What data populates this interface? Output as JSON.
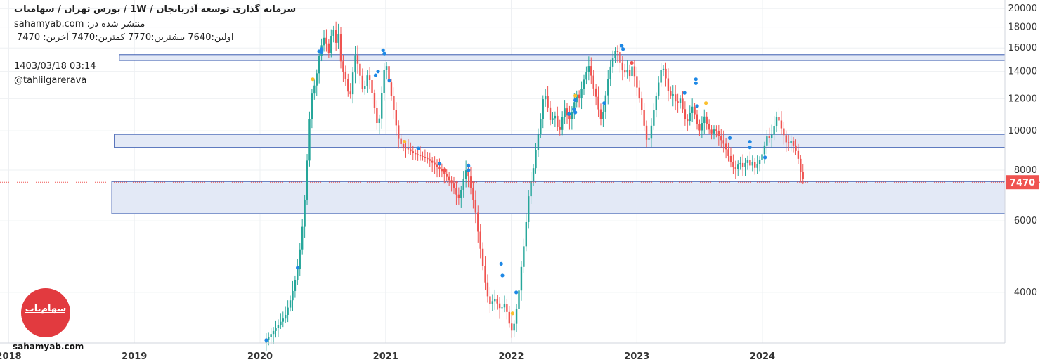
{
  "header": {
    "title": "سرمایه گذاری توسعه آذربایجان  /  1W  /  بورس تهران / سهامیاب",
    "published": "sahamyab.com :منتشر شده در",
    "ohlc_line1": "اولین:7640  بیشترین:7770  کمترین:7470  آخرین:",
    "ohlc_line2": "7470",
    "datetime": "1403/03/18 03:14",
    "author": "@tahlilgarerava"
  },
  "brand": {
    "wordmark": "sahamyab.com",
    "logo_text": "سهام‌یاب",
    "logo_color": "#e23a3f"
  },
  "chart_data": {
    "type": "candlestick",
    "interval": "1W",
    "price_scale": "log",
    "ylim": [
      3000,
      21000
    ],
    "xlim": [
      2017.93,
      2025.93
    ],
    "y_ticks": [
      4000,
      6000,
      8000,
      10000,
      12000,
      14000,
      16000,
      18000,
      20000
    ],
    "y_tick_labels": [
      "4000",
      "6000",
      "8000",
      "10000",
      "12000",
      "14000",
      "16000",
      "18000",
      "20000"
    ],
    "x_ticks": [
      2018,
      2019,
      2020,
      2021,
      2022,
      2023,
      2024
    ],
    "x_tick_labels": [
      "2018",
      "2019",
      "2020",
      "2021",
      "2022",
      "2023",
      "2024"
    ],
    "last_price": 7470,
    "last_price_label": "7470",
    "grid": true,
    "colors": {
      "up": "#26a69a",
      "down": "#ef5350",
      "zone_fill": "#e3e9f6",
      "zone_border": "#3a5bb0",
      "price_tag": "#ef5350",
      "dot_blue": "#1e88e5",
      "dot_yellow": "#fbc02d",
      "dot_red": "#ef5350"
    },
    "zones": [
      {
        "x_start": 2018.88,
        "x_end": 2025.93,
        "low": 14900,
        "high": 15400
      },
      {
        "x_start": 2018.84,
        "x_end": 2025.93,
        "low": 9100,
        "high": 9800
      },
      {
        "x_start": 2018.82,
        "x_end": 2025.93,
        "low": 6250,
        "high": 7500
      }
    ],
    "price_path": [
      [
        2020.03,
        3000
      ],
      [
        2020.12,
        3250
      ],
      [
        2020.2,
        3500
      ],
      [
        2020.25,
        3900
      ],
      [
        2020.3,
        4600
      ],
      [
        2020.33,
        5500
      ],
      [
        2020.36,
        7000
      ],
      [
        2020.38,
        9000
      ],
      [
        2020.4,
        11500
      ],
      [
        2020.42,
        12800
      ],
      [
        2020.44,
        13000
      ],
      [
        2020.46,
        14500
      ],
      [
        2020.48,
        16000
      ],
      [
        2020.5,
        16500
      ],
      [
        2020.52,
        17500
      ],
      [
        2020.54,
        15000
      ],
      [
        2020.56,
        16500
      ],
      [
        2020.58,
        18500
      ],
      [
        2020.6,
        16000
      ],
      [
        2020.62,
        18000
      ],
      [
        2020.64,
        15000
      ],
      [
        2020.66,
        14000
      ],
      [
        2020.68,
        13500
      ],
      [
        2020.7,
        12500
      ],
      [
        2020.72,
        12300
      ],
      [
        2020.74,
        14000
      ],
      [
        2020.76,
        15500
      ],
      [
        2020.78,
        14500
      ],
      [
        2020.8,
        13500
      ],
      [
        2020.82,
        12500
      ],
      [
        2020.84,
        13000
      ],
      [
        2020.86,
        14000
      ],
      [
        2020.88,
        13000
      ],
      [
        2020.9,
        12000
      ],
      [
        2020.92,
        11000
      ],
      [
        2020.94,
        10000
      ],
      [
        2020.96,
        11500
      ],
      [
        2020.98,
        13500
      ],
      [
        2021.0,
        15000
      ],
      [
        2021.02,
        13500
      ],
      [
        2021.04,
        12500
      ],
      [
        2021.06,
        11500
      ],
      [
        2021.08,
        10500
      ],
      [
        2021.1,
        9600
      ],
      [
        2021.12,
        9300
      ],
      [
        2021.14,
        9100
      ],
      [
        2021.18,
        9000
      ],
      [
        2021.22,
        8800
      ],
      [
        2021.26,
        8700
      ],
      [
        2021.3,
        8600
      ],
      [
        2021.34,
        8500
      ],
      [
        2021.38,
        8300
      ],
      [
        2021.42,
        8100
      ],
      [
        2021.46,
        7900
      ],
      [
        2021.5,
        7600
      ],
      [
        2021.54,
        7300
      ],
      [
        2021.56,
        7000
      ],
      [
        2021.58,
        6800
      ],
      [
        2021.6,
        7100
      ],
      [
        2021.62,
        7600
      ],
      [
        2021.64,
        8000
      ],
      [
        2021.66,
        7700
      ],
      [
        2021.68,
        7200
      ],
      [
        2021.7,
        6700
      ],
      [
        2021.72,
        6200
      ],
      [
        2021.74,
        5500
      ],
      [
        2021.76,
        5000
      ],
      [
        2021.78,
        4500
      ],
      [
        2021.8,
        4100
      ],
      [
        2021.82,
        3800
      ],
      [
        2021.84,
        3700
      ],
      [
        2021.86,
        3900
      ],
      [
        2021.88,
        3800
      ],
      [
        2021.9,
        3700
      ],
      [
        2021.92,
        3600
      ],
      [
        2021.94,
        3800
      ],
      [
        2021.96,
        3650
      ],
      [
        2021.98,
        3400
      ],
      [
        2022.0,
        3200
      ],
      [
        2022.02,
        3300
      ],
      [
        2022.04,
        3600
      ],
      [
        2022.06,
        4000
      ],
      [
        2022.08,
        4600
      ],
      [
        2022.1,
        5200
      ],
      [
        2022.12,
        6000
      ],
      [
        2022.14,
        7000
      ],
      [
        2022.16,
        7600
      ],
      [
        2022.18,
        8200
      ],
      [
        2022.2,
        9200
      ],
      [
        2022.22,
        10000
      ],
      [
        2022.24,
        11000
      ],
      [
        2022.26,
        12500
      ],
      [
        2022.28,
        12000
      ],
      [
        2022.3,
        11000
      ],
      [
        2022.32,
        10300
      ],
      [
        2022.34,
        11200
      ],
      [
        2022.36,
        10500
      ],
      [
        2022.38,
        9800
      ],
      [
        2022.4,
        10500
      ],
      [
        2022.42,
        11500
      ],
      [
        2022.44,
        11000
      ],
      [
        2022.46,
        10600
      ],
      [
        2022.48,
        11000
      ],
      [
        2022.5,
        11700
      ],
      [
        2022.52,
        12300
      ],
      [
        2022.54,
        12000
      ],
      [
        2022.56,
        12700
      ],
      [
        2022.58,
        13400
      ],
      [
        2022.6,
        14000
      ],
      [
        2022.62,
        14500
      ],
      [
        2022.64,
        13500
      ],
      [
        2022.66,
        12500
      ],
      [
        2022.68,
        12000
      ],
      [
        2022.7,
        11000
      ],
      [
        2022.72,
        10500
      ],
      [
        2022.74,
        11500
      ],
      [
        2022.76,
        12800
      ],
      [
        2022.78,
        14000
      ],
      [
        2022.8,
        14800
      ],
      [
        2022.82,
        15500
      ],
      [
        2022.84,
        16000
      ],
      [
        2022.86,
        15000
      ],
      [
        2022.88,
        14200
      ],
      [
        2022.9,
        13800
      ],
      [
        2022.92,
        14300
      ],
      [
        2022.94,
        13500
      ],
      [
        2022.96,
        14500
      ],
      [
        2022.98,
        13700
      ],
      [
        2023.0,
        12800
      ],
      [
        2023.02,
        12000
      ],
      [
        2023.04,
        11200
      ],
      [
        2023.06,
        10200
      ],
      [
        2023.08,
        9400
      ],
      [
        2023.1,
        9600
      ],
      [
        2023.12,
        10500
      ],
      [
        2023.14,
        11500
      ],
      [
        2023.16,
        12500
      ],
      [
        2023.18,
        13500
      ],
      [
        2023.2,
        14500
      ],
      [
        2023.22,
        14000
      ],
      [
        2023.24,
        13000
      ],
      [
        2023.26,
        12000
      ],
      [
        2023.28,
        12500
      ],
      [
        2023.3,
        12000
      ],
      [
        2023.32,
        11500
      ],
      [
        2023.34,
        12200
      ],
      [
        2023.36,
        11500
      ],
      [
        2023.38,
        10700
      ],
      [
        2023.4,
        10500
      ],
      [
        2023.42,
        11000
      ],
      [
        2023.44,
        11500
      ],
      [
        2023.46,
        11000
      ],
      [
        2023.48,
        10400
      ],
      [
        2023.5,
        10000
      ],
      [
        2023.52,
        10500
      ],
      [
        2023.54,
        10900
      ],
      [
        2023.56,
        10300
      ],
      [
        2023.58,
        10000
      ],
      [
        2023.6,
        9800
      ],
      [
        2023.62,
        10200
      ],
      [
        2023.64,
        9900
      ],
      [
        2023.66,
        9600
      ],
      [
        2023.68,
        9400
      ],
      [
        2023.7,
        9200
      ],
      [
        2023.72,
        8800
      ],
      [
        2023.74,
        8500
      ],
      [
        2023.76,
        8200
      ],
      [
        2023.78,
        8000
      ],
      [
        2023.8,
        8200
      ],
      [
        2023.82,
        8400
      ],
      [
        2023.84,
        8100
      ],
      [
        2023.86,
        8300
      ],
      [
        2023.88,
        8500
      ],
      [
        2023.9,
        8200
      ],
      [
        2023.92,
        8400
      ],
      [
        2023.94,
        8100
      ],
      [
        2023.96,
        8300
      ],
      [
        2023.98,
        8500
      ],
      [
        2024.0,
        8800
      ],
      [
        2024.02,
        9300
      ],
      [
        2024.04,
        9800
      ],
      [
        2024.06,
        9500
      ],
      [
        2024.08,
        9900
      ],
      [
        2024.1,
        10500
      ],
      [
        2024.12,
        11000
      ],
      [
        2024.14,
        10300
      ],
      [
        2024.16,
        10000
      ],
      [
        2024.18,
        9500
      ],
      [
        2024.2,
        9200
      ],
      [
        2024.22,
        9500
      ],
      [
        2024.24,
        9300
      ],
      [
        2024.26,
        9000
      ],
      [
        2024.28,
        8700
      ],
      [
        2024.3,
        8000
      ],
      [
        2024.32,
        7640
      ],
      [
        2024.34,
        7470
      ]
    ],
    "signal_dots": [
      {
        "x": 2020.05,
        "y": 3050,
        "c": "blue"
      },
      {
        "x": 2020.3,
        "y": 4600,
        "c": "blue"
      },
      {
        "x": 2020.42,
        "y": 13400,
        "c": "yellow"
      },
      {
        "x": 2020.47,
        "y": 15700,
        "c": "blue"
      },
      {
        "x": 2020.49,
        "y": 15900,
        "c": "blue"
      },
      {
        "x": 2020.49,
        "y": 15600,
        "c": "blue"
      },
      {
        "x": 2020.92,
        "y": 13700,
        "c": "blue"
      },
      {
        "x": 2020.94,
        "y": 14000,
        "c": "blue"
      },
      {
        "x": 2020.98,
        "y": 15800,
        "c": "blue"
      },
      {
        "x": 2020.99,
        "y": 15500,
        "c": "blue"
      },
      {
        "x": 2021.03,
        "y": 13300,
        "c": "blue"
      },
      {
        "x": 2021.15,
        "y": 9400,
        "c": "yellow"
      },
      {
        "x": 2021.26,
        "y": 9050,
        "c": "blue"
      },
      {
        "x": 2021.43,
        "y": 8300,
        "c": "blue"
      },
      {
        "x": 2021.47,
        "y": 8000,
        "c": "red"
      },
      {
        "x": 2021.66,
        "y": 8200,
        "c": "blue"
      },
      {
        "x": 2021.66,
        "y": 8000,
        "c": "blue"
      },
      {
        "x": 2021.92,
        "y": 4700,
        "c": "blue"
      },
      {
        "x": 2021.93,
        "y": 4400,
        "c": "blue"
      },
      {
        "x": 2022.04,
        "y": 4000,
        "c": "blue"
      },
      {
        "x": 2022.01,
        "y": 3550,
        "c": "yellow"
      },
      {
        "x": 2022.46,
        "y": 11000,
        "c": "blue"
      },
      {
        "x": 2022.5,
        "y": 11300,
        "c": "blue"
      },
      {
        "x": 2022.51,
        "y": 11100,
        "c": "blue"
      },
      {
        "x": 2022.51,
        "y": 11900,
        "c": "blue"
      },
      {
        "x": 2022.51,
        "y": 12200,
        "c": "yellow"
      },
      {
        "x": 2022.74,
        "y": 11700,
        "c": "blue"
      },
      {
        "x": 2022.88,
        "y": 16200,
        "c": "blue"
      },
      {
        "x": 2022.89,
        "y": 15900,
        "c": "blue"
      },
      {
        "x": 2022.96,
        "y": 14700,
        "c": "red"
      },
      {
        "x": 2023.38,
        "y": 12400,
        "c": "blue"
      },
      {
        "x": 2023.47,
        "y": 13400,
        "c": "blue"
      },
      {
        "x": 2023.47,
        "y": 13100,
        "c": "blue"
      },
      {
        "x": 2023.48,
        "y": 11500,
        "c": "blue"
      },
      {
        "x": 2023.55,
        "y": 11700,
        "c": "yellow"
      },
      {
        "x": 2023.74,
        "y": 9600,
        "c": "blue"
      },
      {
        "x": 2023.9,
        "y": 9400,
        "c": "blue"
      },
      {
        "x": 2023.9,
        "y": 9100,
        "c": "blue"
      },
      {
        "x": 2024.02,
        "y": 8600,
        "c": "blue"
      }
    ]
  }
}
